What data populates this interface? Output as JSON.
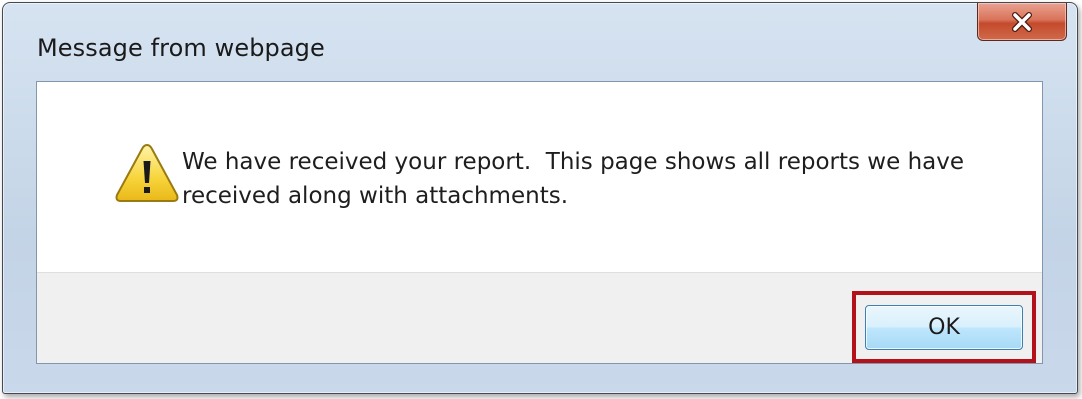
{
  "window": {
    "title": "Message from webpage",
    "close_icon": "close-icon"
  },
  "dialog": {
    "icon": "warning-icon",
    "message_line1": "We have received your report.  This page shows all reports we have",
    "message_line2": "received along with attachments."
  },
  "buttons": {
    "ok_label": "OK"
  },
  "colors": {
    "highlight": "#b3121b",
    "close_button": "#c44a2c",
    "ok_button_border": "#3c7fb1"
  }
}
